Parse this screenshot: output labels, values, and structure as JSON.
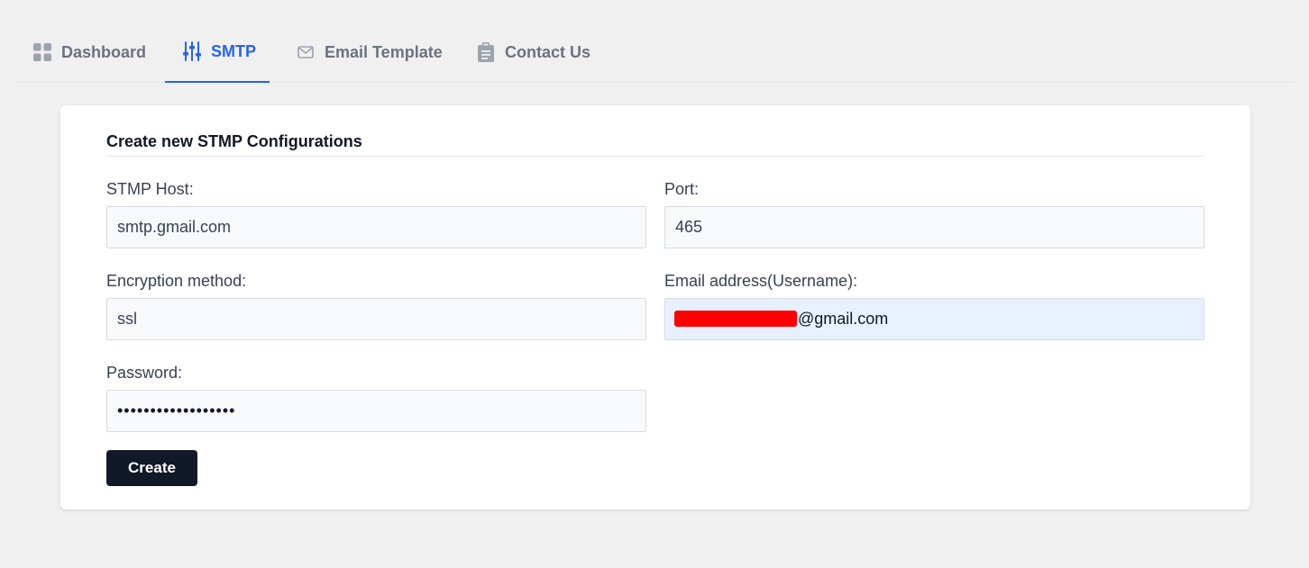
{
  "tabs": [
    {
      "label": "Dashboard",
      "icon": "grid-icon",
      "active": false
    },
    {
      "label": "SMTP",
      "icon": "sliders-icon",
      "active": true
    },
    {
      "label": "Email Template",
      "icon": "envelope-icon",
      "active": false
    },
    {
      "label": "Contact Us",
      "icon": "clipboard-icon",
      "active": false
    }
  ],
  "form": {
    "title": "Create new STMP Configurations",
    "host": {
      "label": "STMP Host:",
      "value": "smtp.gmail.com"
    },
    "port": {
      "label": "Port:",
      "value": "465"
    },
    "encryption": {
      "label": "Encryption method:",
      "value": "ssl"
    },
    "email": {
      "label": "Email address(Username):",
      "value": "@gmail.com"
    },
    "password": {
      "label": "Password:",
      "value": "••••••••••••••••••"
    },
    "submit_label": "Create"
  },
  "colors": {
    "accent": "#2563eb",
    "button": "#111827",
    "background": "#f0f0f0",
    "redaction": "#ff0000"
  }
}
